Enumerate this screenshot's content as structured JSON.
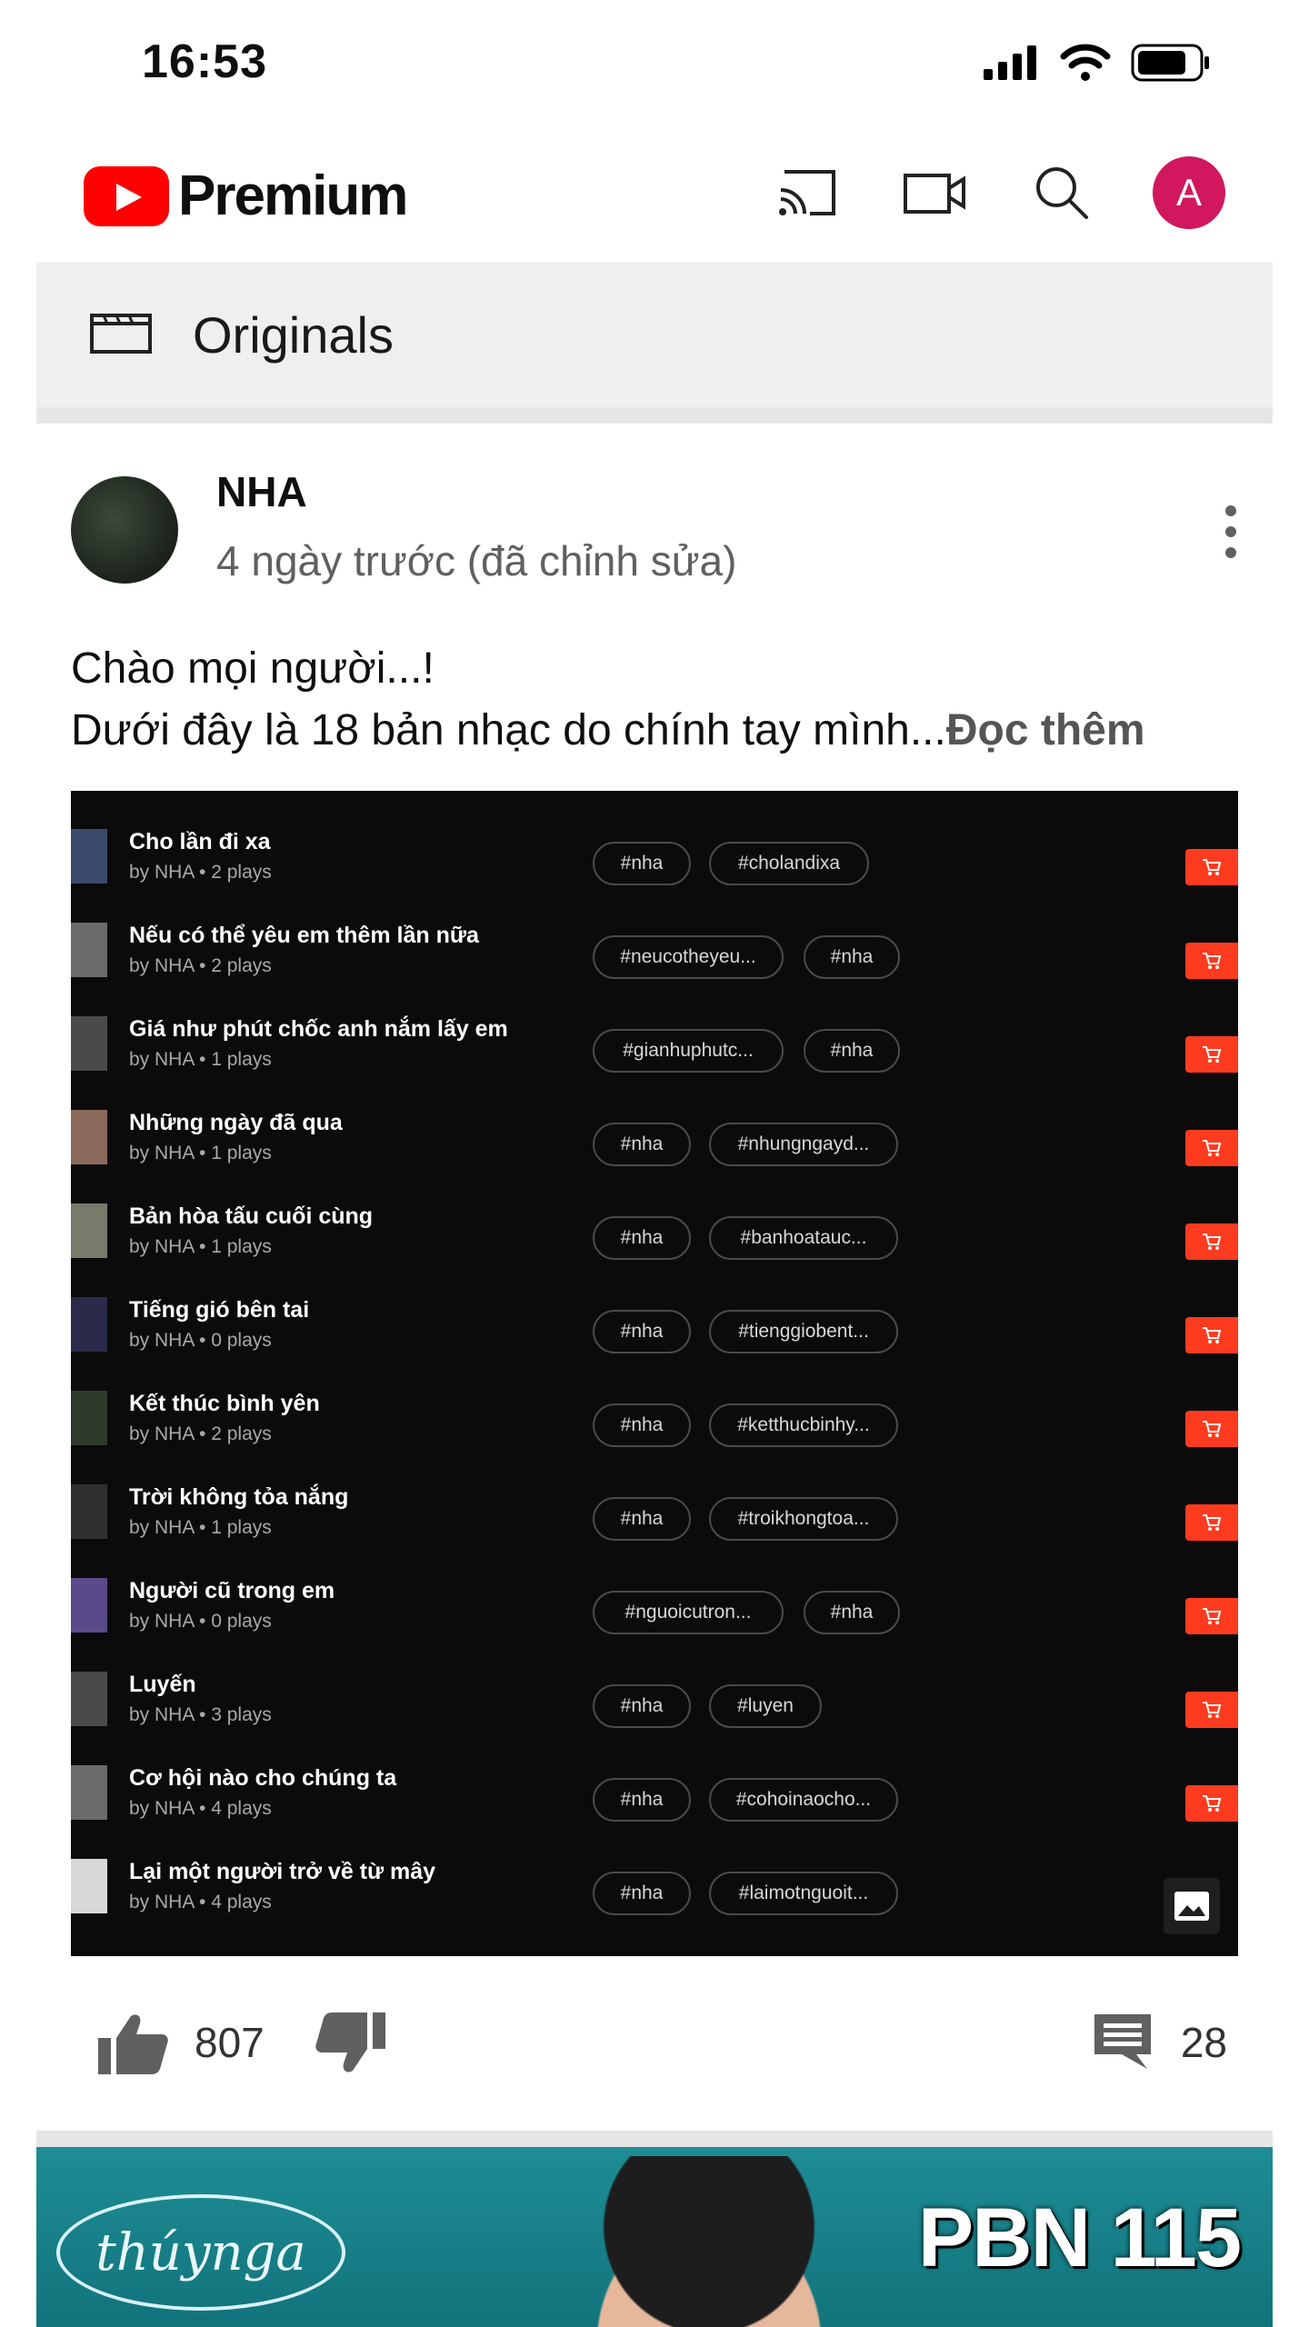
{
  "status_bar": {
    "time": "16:53"
  },
  "app": {
    "brand": "Premium"
  },
  "section": {
    "label": "Originals"
  },
  "post": {
    "author": "NHA",
    "meta": "4 ngày trước (đã chỉnh sửa)",
    "line1": "Chào mọi người...!",
    "line2": "Dưới đây là 18 bản nhạc do chính tay mình...",
    "read_more": "Đọc thêm",
    "likes": "807",
    "comments": "28"
  },
  "tracks": [
    {
      "title": "Cho lần đi xa",
      "by": "by NHA • 2 plays",
      "tags": [
        "#nha",
        "#cholandixa"
      ]
    },
    {
      "title": "Nếu có thể yêu em thêm lần nữa",
      "by": "by NHA • 2 plays",
      "tags": [
        "#neucotheyeu...",
        "#nha"
      ]
    },
    {
      "title": "Giá như phút chốc anh nắm lấy em",
      "by": "by NHA • 1 plays",
      "tags": [
        "#gianhuphutc...",
        "#nha"
      ]
    },
    {
      "title": "Những ngày đã qua",
      "by": "by NHA • 1 plays",
      "tags": [
        "#nha",
        "#nhungngayd..."
      ]
    },
    {
      "title": "Bản hòa tấu cuối cùng",
      "by": "by NHA • 1 plays",
      "tags": [
        "#nha",
        "#banhoatauc..."
      ]
    },
    {
      "title": "Tiếng gió bên tai",
      "by": "by NHA • 0 plays",
      "tags": [
        "#nha",
        "#tienggiobent..."
      ]
    },
    {
      "title": "Kết thúc bình yên",
      "by": "by NHA • 2 plays",
      "tags": [
        "#nha",
        "#ketthucbinhy..."
      ]
    },
    {
      "title": "Trời không tỏa nắng",
      "by": "by NHA • 1 plays",
      "tags": [
        "#nha",
        "#troikhongtoa..."
      ]
    },
    {
      "title": "Người cũ trong em",
      "by": "by NHA • 0 plays",
      "tags": [
        "#nguoicutron...",
        "#nha"
      ]
    },
    {
      "title": "Luyến",
      "by": "by NHA • 3 plays",
      "tags": [
        "#nha",
        "#luyen"
      ]
    },
    {
      "title": "Cơ hội nào cho chúng ta",
      "by": "by NHA • 4 plays",
      "tags": [
        "#nha",
        "#cohoinaocho..."
      ]
    },
    {
      "title": "Lại một người trở về từ mây",
      "by": "by NHA • 4 plays",
      "tags": [
        "#nha",
        "#laimotnguoit..."
      ]
    }
  ],
  "next_thumbnail": {
    "logo_text": "thúynga",
    "title": "PBN 115"
  },
  "colors": {
    "accent": "#ff0000",
    "avatar": "#d1175d",
    "cart": "#ff3b1f"
  }
}
